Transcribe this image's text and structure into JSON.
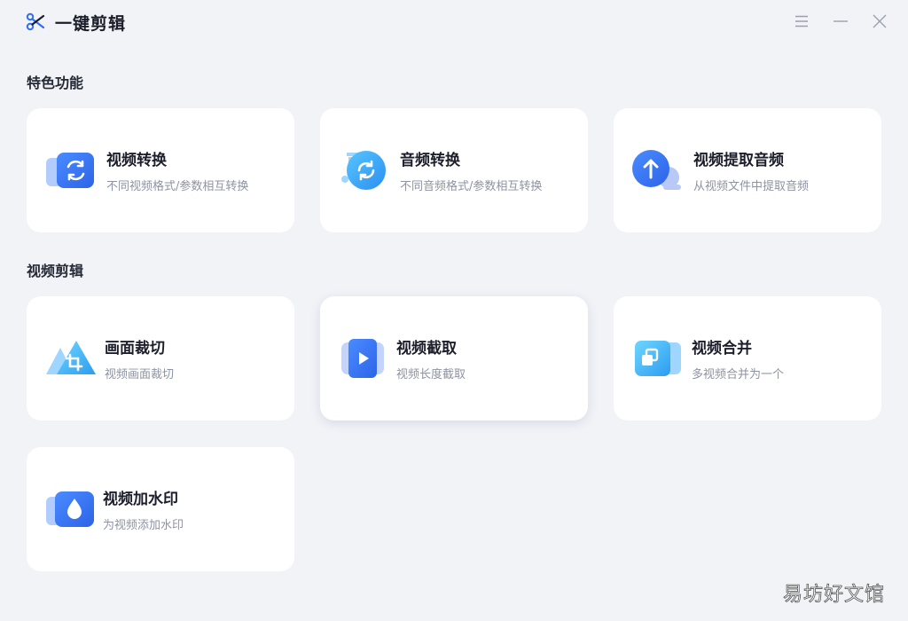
{
  "app": {
    "title": "一键剪辑",
    "logo_icon": "scissors-icon",
    "accent": "#2f6ff0"
  },
  "window_controls": {
    "menu_icon": "menu-icon",
    "minimize_icon": "minimize-icon",
    "close_icon": "close-icon"
  },
  "sections": [
    {
      "title": "特色功能",
      "cards": [
        {
          "label": "视频转换",
          "desc": "不同视频格式/参数相互转换",
          "icon": "video-convert-icon"
        },
        {
          "label": "音频转换",
          "desc": "不同音频格式/参数相互转换",
          "icon": "audio-convert-icon"
        },
        {
          "label": "视频提取音频",
          "desc": "从视频文件中提取音频",
          "icon": "extract-audio-icon"
        }
      ]
    },
    {
      "title": "视频剪辑",
      "cards": [
        {
          "label": "画面裁切",
          "desc": "视频画面裁切",
          "icon": "crop-icon"
        },
        {
          "label": "视频截取",
          "desc": "视频长度截取",
          "icon": "video-trim-icon"
        },
        {
          "label": "视频合并",
          "desc": "多视频合并为一个",
          "icon": "video-merge-icon"
        },
        {
          "label": "视频加水印",
          "desc": "为视频添加水印",
          "icon": "watermark-icon"
        }
      ]
    }
  ],
  "watermark_text": "易坊好文馆"
}
